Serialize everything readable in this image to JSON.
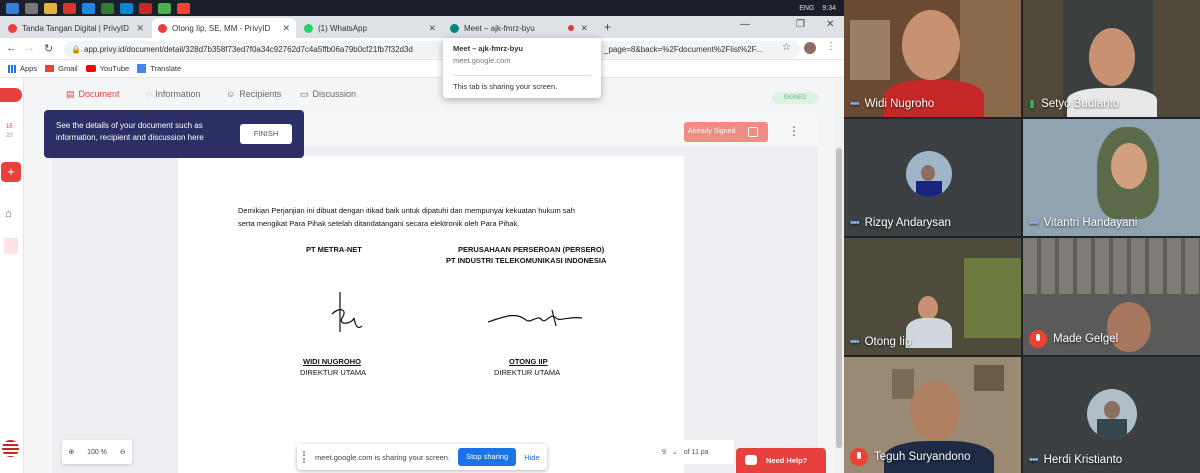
{
  "taskbar": {
    "language": "ENG",
    "time": "9:34"
  },
  "tabs": [
    {
      "title": "Tanda Tangan Digital | PrivyID"
    },
    {
      "title": "Otong Iip, SE, MM - PrivyID"
    },
    {
      "title": "(1) WhatsApp"
    },
    {
      "title": "Meet – ajk-fmrz-byu"
    }
  ],
  "new_tab": "+",
  "address": {
    "url": "app.privy.id/document/detail/328d7b358f73ed7f0a34c92762d7c4a5ffb06a79b0cf21fb7f32d3d",
    "url_tail": "_page=8&back=%2Fdocument%2Flist%2F..."
  },
  "bookmarks": [
    "Apps",
    "Gmail",
    "YouTube",
    "Translate"
  ],
  "tab_popup": {
    "title": "Meet – ajk-fmrz-byu",
    "domain": "meet.google.com",
    "note": "This tab is sharing your screen."
  },
  "docnav": {
    "document": "Document",
    "information": "Information",
    "recipients": "Recipients",
    "discussion": "Discussion",
    "status": "SIGNED"
  },
  "tour": {
    "text": "See the details of your document such as information, recipient and discussion here",
    "finish": "FINISH"
  },
  "already_signed": "Already Signed",
  "document": {
    "para1": "Demikian Perjanjian ini dibuat dengan itikad baik untuk dipatuhi dan mempunyai kekuatan hukum sah",
    "para2": "serta mengikat Para Pihak setelah ditandatangani secara elektronik oleh Para Pihak.",
    "left_party": "PT METRA-NET",
    "right_party1": "PERUSAHAAN PERSEROAN (PERSERO)",
    "right_party2": "PT INDUSTRI TELEKOMUNIKASI INDONESIA",
    "left_name": "WIDI NUGROHO",
    "left_title": "DIREKTUR UTAMA",
    "right_name": "OTONG IIP",
    "right_title": "DIREKTUR UTAMA"
  },
  "zoom": {
    "value": "100 %"
  },
  "sharebar": {
    "text": "meet.google.com is sharing your screen.",
    "stop": "Stop sharing",
    "hide": "Hide"
  },
  "pager": {
    "page": "9",
    "of": "of 11 pa"
  },
  "need_help": "Need Help?",
  "leftrail": {
    "counter": "15",
    "sub": "23"
  },
  "participants": [
    {
      "name": "Widi Nugroho",
      "status": "dots"
    },
    {
      "name": "Setyo Budianto",
      "status": "speaking"
    },
    {
      "name": "Rizqy Andarysan",
      "status": "dots"
    },
    {
      "name": "Vitantri Handayani",
      "status": "dots"
    },
    {
      "name": "Otong Iip",
      "status": "dots"
    },
    {
      "name": "Made Gelgel",
      "status": "muted"
    },
    {
      "name": "Teguh Suryandono",
      "status": "muted"
    },
    {
      "name": "Herdi Kristianto",
      "status": "dots"
    }
  ],
  "colors": {
    "privy_red": "#e8403f",
    "tour_bg": "#2b2f66",
    "meet_bg": "#202124",
    "muted_red": "#ea4335",
    "chrome_blue": "#1a73e8"
  }
}
